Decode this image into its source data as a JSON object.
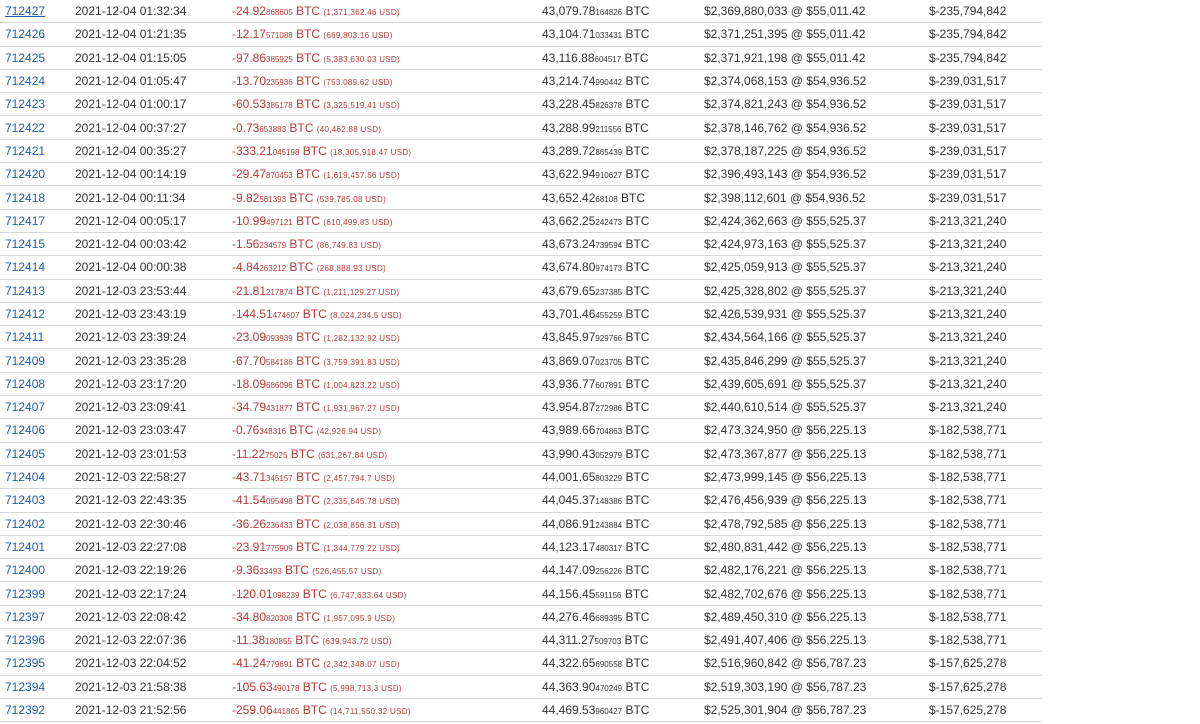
{
  "rows": [
    {
      "block": "712427",
      "time": "2021-12-04 01:32:34",
      "change_main": "-24.92",
      "change_small": "868605",
      "change_unit": "BTC",
      "change_usd": "(1,371,362.46 USD)",
      "balance_main": "43,079.78",
      "balance_small": "164826",
      "balance_unit": "BTC",
      "value": "$2,369,880,033 @ $55,011.42",
      "diff": "$-235,794,842"
    },
    {
      "block": "712426",
      "time": "2021-12-04 01:21:35",
      "change_main": "-12.17",
      "change_small": "571088",
      "change_unit": "BTC",
      "change_usd": "(669,803.16 USD)",
      "balance_main": "43,104.71",
      "balance_small": "033431",
      "balance_unit": "BTC",
      "value": "$2,371,251,395 @ $55,011.42",
      "diff": "$-235,794,842"
    },
    {
      "block": "712425",
      "time": "2021-12-04 01:15:05",
      "change_main": "-97.86",
      "change_small": "385925",
      "change_unit": "BTC",
      "change_usd": "(5,383,630.03 USD)",
      "balance_main": "43,116.88",
      "balance_small": "604517",
      "balance_unit": "BTC",
      "value": "$2,371,921,198 @ $55,011.42",
      "diff": "$-235,794,842"
    },
    {
      "block": "712424",
      "time": "2021-12-04 01:05:47",
      "change_main": "-13.70",
      "change_small": "235936",
      "change_unit": "BTC",
      "change_usd": "(753,089.62 USD)",
      "balance_main": "43,214.74",
      "balance_small": "990442",
      "balance_unit": "BTC",
      "value": "$2,374,068,153 @ $54,936.52",
      "diff": "$-239,031,517"
    },
    {
      "block": "712423",
      "time": "2021-12-04 01:00:17",
      "change_main": "-60.53",
      "change_small": "385178",
      "change_unit": "BTC",
      "change_usd": "(3,325,519.41 USD)",
      "balance_main": "43,228.45",
      "balance_small": "826378",
      "balance_unit": "BTC",
      "value": "$2,374,821,243 @ $54,936.52",
      "diff": "$-239,031,517"
    },
    {
      "block": "712422",
      "time": "2021-12-04 00:37:27",
      "change_main": "-0.73",
      "change_small": "653883",
      "change_unit": "BTC",
      "change_usd": "(40,462.88 USD)",
      "balance_main": "43,288.99",
      "balance_small": "211556",
      "balance_unit": "BTC",
      "value": "$2,378,146,762 @ $54,936.52",
      "diff": "$-239,031,517"
    },
    {
      "block": "712421",
      "time": "2021-12-04 00:35:27",
      "change_main": "-333.21",
      "change_small": "045198",
      "change_unit": "BTC",
      "change_usd": "(18,305,918.47 USD)",
      "balance_main": "43,289.72",
      "balance_small": "865439",
      "balance_unit": "BTC",
      "value": "$2,378,187,225 @ $54,936.52",
      "diff": "$-239,031,517"
    },
    {
      "block": "712420",
      "time": "2021-12-04 00:14:19",
      "change_main": "-29.47",
      "change_small": "870453",
      "change_unit": "BTC",
      "change_usd": "(1,619,457.56 USD)",
      "balance_main": "43,622.94",
      "balance_small": "910627",
      "balance_unit": "BTC",
      "value": "$2,396,493,143 @ $54,936.52",
      "diff": "$-239,031,517"
    },
    {
      "block": "712418",
      "time": "2021-12-04 00:11:34",
      "change_main": "-9.82",
      "change_small": "561393",
      "change_unit": "BTC",
      "change_usd": "(539,785.08 USD)",
      "balance_main": "43,652.42",
      "balance_small": "68108",
      "balance_unit": "BTC",
      "value": "$2,398,112,601 @ $54,936.52",
      "diff": "$-239,031,517"
    },
    {
      "block": "712417",
      "time": "2021-12-04 00:05:17",
      "change_main": "-10.99",
      "change_small": "497121",
      "change_unit": "BTC",
      "change_usd": "(610,499.83 USD)",
      "balance_main": "43,662.25",
      "balance_small": "242473",
      "balance_unit": "BTC",
      "value": "$2,424,362,663 @ $55,525.37",
      "diff": "$-213,321,240"
    },
    {
      "block": "712415",
      "time": "2021-12-04 00:03:42",
      "change_main": "-1.56",
      "change_small": "234579",
      "change_unit": "BTC",
      "change_usd": "(86,749.83 USD)",
      "balance_main": "43,673.24",
      "balance_small": "739594",
      "balance_unit": "BTC",
      "value": "$2,424,973,163 @ $55,525.37",
      "diff": "$-213,321,240"
    },
    {
      "block": "712414",
      "time": "2021-12-04 00:00:38",
      "change_main": "-4.84",
      "change_small": "263212",
      "change_unit": "BTC",
      "change_usd": "(268,888.93 USD)",
      "balance_main": "43,674.80",
      "balance_small": "974173",
      "balance_unit": "BTC",
      "value": "$2,425,059,913 @ $55,525.37",
      "diff": "$-213,321,240"
    },
    {
      "block": "712413",
      "time": "2021-12-03 23:53:44",
      "change_main": "-21.81",
      "change_small": "217874",
      "change_unit": "BTC",
      "change_usd": "(1,211,129.27 USD)",
      "balance_main": "43,679.65",
      "balance_small": "237385",
      "balance_unit": "BTC",
      "value": "$2,425,328,802 @ $55,525.37",
      "diff": "$-213,321,240"
    },
    {
      "block": "712412",
      "time": "2021-12-03 23:43:19",
      "change_main": "-144.51",
      "change_small": "474607",
      "change_unit": "BTC",
      "change_usd": "(8,024,234.5 USD)",
      "balance_main": "43,701.46",
      "balance_small": "455259",
      "balance_unit": "BTC",
      "value": "$2,426,539,931 @ $55,525.37",
      "diff": "$-213,321,240"
    },
    {
      "block": "712411",
      "time": "2021-12-03 23:39:24",
      "change_main": "-23.09",
      "change_small": "093939",
      "change_unit": "BTC",
      "change_usd": "(1,282,132.92 USD)",
      "balance_main": "43,845.97",
      "balance_small": "929766",
      "balance_unit": "BTC",
      "value": "$2,434,564,166 @ $55,525.37",
      "diff": "$-213,321,240"
    },
    {
      "block": "712409",
      "time": "2021-12-03 23:35:28",
      "change_main": "-67.70",
      "change_small": "584186",
      "change_unit": "BTC",
      "change_usd": "(3,759,391.83 USD)",
      "balance_main": "43,869.07",
      "balance_small": "023705",
      "balance_unit": "BTC",
      "value": "$2,435,846,299 @ $55,525.37",
      "diff": "$-213,321,240"
    },
    {
      "block": "712408",
      "time": "2021-12-03 23:17:20",
      "change_main": "-18.09",
      "change_small": "686096",
      "change_unit": "BTC",
      "change_usd": "(1,004,823.22 USD)",
      "balance_main": "43,936.77",
      "balance_small": "607891",
      "balance_unit": "BTC",
      "value": "$2,439,605,691 @ $55,525.37",
      "diff": "$-213,321,240"
    },
    {
      "block": "712407",
      "time": "2021-12-03 23:09:41",
      "change_main": "-34.79",
      "change_small": "431877",
      "change_unit": "BTC",
      "change_usd": "(1,931,967.27 USD)",
      "balance_main": "43,954.87",
      "balance_small": "272986",
      "balance_unit": "BTC",
      "value": "$2,440,610,514 @ $55,525.37",
      "diff": "$-213,321,240"
    },
    {
      "block": "712406",
      "time": "2021-12-03 23:03:47",
      "change_main": "-0.76",
      "change_small": "348316",
      "change_unit": "BTC",
      "change_usd": "(42,926.94 USD)",
      "balance_main": "43,989.66",
      "balance_small": "704863",
      "balance_unit": "BTC",
      "value": "$2,473,324,950 @ $56,225.13",
      "diff": "$-182,538,771"
    },
    {
      "block": "712405",
      "time": "2021-12-03 23:01:53",
      "change_main": "-11.22",
      "change_small": "75025",
      "change_unit": "BTC",
      "change_usd": "(631,267.84 USD)",
      "balance_main": "43,990.43",
      "balance_small": "052979",
      "balance_unit": "BTC",
      "value": "$2,473,367,877 @ $56,225.13",
      "diff": "$-182,538,771"
    },
    {
      "block": "712404",
      "time": "2021-12-03 22:58:27",
      "change_main": "-43.71",
      "change_small": "345157",
      "change_unit": "BTC",
      "change_usd": "(2,457,794.7 USD)",
      "balance_main": "44,001.65",
      "balance_small": "803229",
      "balance_unit": "BTC",
      "value": "$2,473,999,145 @ $56,225.13",
      "diff": "$-182,538,771"
    },
    {
      "block": "712403",
      "time": "2021-12-03 22:43:35",
      "change_main": "-41.54",
      "change_small": "095498",
      "change_unit": "BTC",
      "change_usd": "(2,335,645.78 USD)",
      "balance_main": "44,045.37",
      "balance_small": "148386",
      "balance_unit": "BTC",
      "value": "$2,476,456,939 @ $56,225.13",
      "diff": "$-182,538,771"
    },
    {
      "block": "712402",
      "time": "2021-12-03 22:30:46",
      "change_main": "-36.26",
      "change_small": "236433",
      "change_unit": "BTC",
      "change_usd": "(2,038,856.31 USD)",
      "balance_main": "44,086.91",
      "balance_small": "243884",
      "balance_unit": "BTC",
      "value": "$2,478,792,585 @ $56,225.13",
      "diff": "$-182,538,771"
    },
    {
      "block": "712401",
      "time": "2021-12-03 22:27:08",
      "change_main": "-23.91",
      "change_small": "775909",
      "change_unit": "BTC",
      "change_usd": "(1,344,779.22 USD)",
      "balance_main": "44,123.17",
      "balance_small": "480317",
      "balance_unit": "BTC",
      "value": "$2,480,831,442 @ $56,225.13",
      "diff": "$-182,538,771"
    },
    {
      "block": "712400",
      "time": "2021-12-03 22:19:26",
      "change_main": "-9.36",
      "change_small": "33493",
      "change_unit": "BTC",
      "change_usd": "(526,455.57 USD)",
      "balance_main": "44,147.09",
      "balance_small": "256226",
      "balance_unit": "BTC",
      "value": "$2,482,176,221 @ $56,225.13",
      "diff": "$-182,538,771"
    },
    {
      "block": "712399",
      "time": "2021-12-03 22:17:24",
      "change_main": "-120.01",
      "change_small": "098239",
      "change_unit": "BTC",
      "change_usd": "(6,747,633.64 USD)",
      "balance_main": "44,156.45",
      "balance_small": "591156",
      "balance_unit": "BTC",
      "value": "$2,482,702,676 @ $56,225.13",
      "diff": "$-182,538,771"
    },
    {
      "block": "712397",
      "time": "2021-12-03 22:08:42",
      "change_main": "-34.80",
      "change_small": "820308",
      "change_unit": "BTC",
      "change_usd": "(1,957,095.9 USD)",
      "balance_main": "44,276.46",
      "balance_small": "689395",
      "balance_unit": "BTC",
      "value": "$2,489,450,310 @ $56,225.13",
      "diff": "$-182,538,771"
    },
    {
      "block": "712396",
      "time": "2021-12-03 22:07:36",
      "change_main": "-11.38",
      "change_small": "180855",
      "change_unit": "BTC",
      "change_usd": "(639,943.72 USD)",
      "balance_main": "44,311.27",
      "balance_small": "509703",
      "balance_unit": "BTC",
      "value": "$2,491,407,406 @ $56,225.13",
      "diff": "$-182,538,771"
    },
    {
      "block": "712395",
      "time": "2021-12-03 22:04:52",
      "change_main": "-41.24",
      "change_small": "779691",
      "change_unit": "BTC",
      "change_usd": "(2,342,348.07 USD)",
      "balance_main": "44,322.65",
      "balance_small": "690558",
      "balance_unit": "BTC",
      "value": "$2,516,960,842 @ $56,787.23",
      "diff": "$-157,625,278"
    },
    {
      "block": "712394",
      "time": "2021-12-03 21:58:38",
      "change_main": "-105.63",
      "change_small": "490178",
      "change_unit": "BTC",
      "change_usd": "(5,998,713.3 USD)",
      "balance_main": "44,363.90",
      "balance_small": "470249",
      "balance_unit": "BTC",
      "value": "$2,519,303,190 @ $56,787.23",
      "diff": "$-157,625,278"
    },
    {
      "block": "712392",
      "time": "2021-12-03 21:52:56",
      "change_main": "-259.06",
      "change_small": "441865",
      "change_unit": "BTC",
      "change_usd": "(14,711,550.32 USD)",
      "balance_main": "44,469.53",
      "balance_small": "960427",
      "balance_unit": "BTC",
      "value": "$2,525,301,904 @ $56,787.23",
      "diff": "$-157,625,278"
    }
  ]
}
